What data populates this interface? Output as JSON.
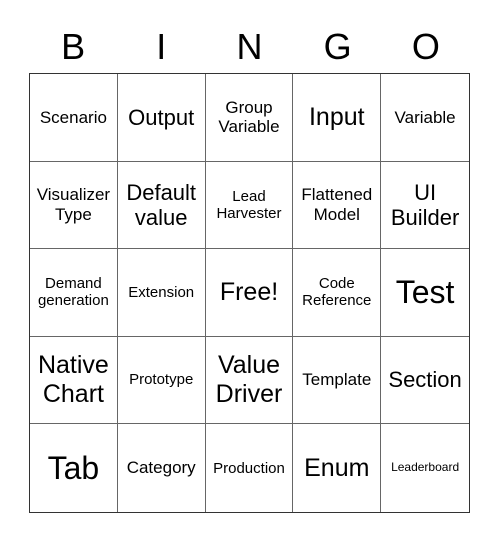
{
  "header": {
    "letters": [
      "B",
      "I",
      "N",
      "G",
      "O"
    ]
  },
  "board": {
    "rows": [
      [
        {
          "text": "Scenario",
          "size": "md"
        },
        {
          "text": "Output",
          "size": "lg"
        },
        {
          "text": "Group Variable",
          "size": "md"
        },
        {
          "text": "Input",
          "size": "xl"
        },
        {
          "text": "Variable",
          "size": "md"
        }
      ],
      [
        {
          "text": "Visualizer Type",
          "size": "md"
        },
        {
          "text": "Default value",
          "size": "lg"
        },
        {
          "text": "Lead Harvester",
          "size": "sm"
        },
        {
          "text": "Flattened Model",
          "size": "md"
        },
        {
          "text": "UI Builder",
          "size": "lg"
        }
      ],
      [
        {
          "text": "Demand generation",
          "size": "sm"
        },
        {
          "text": "Extension",
          "size": "sm"
        },
        {
          "text": "Free!",
          "size": "xl",
          "free": true
        },
        {
          "text": "Code Reference",
          "size": "sm"
        },
        {
          "text": "Test",
          "size": "xxl"
        }
      ],
      [
        {
          "text": "Native Chart",
          "size": "xl"
        },
        {
          "text": "Prototype",
          "size": "sm"
        },
        {
          "text": "Value Driver",
          "size": "xl"
        },
        {
          "text": "Template",
          "size": "md"
        },
        {
          "text": "Section",
          "size": "lg"
        }
      ],
      [
        {
          "text": "Tab",
          "size": "xxl"
        },
        {
          "text": "Category",
          "size": "md"
        },
        {
          "text": "Production",
          "size": "sm"
        },
        {
          "text": "Enum",
          "size": "xl"
        },
        {
          "text": "Leaderboard",
          "size": "xs"
        }
      ]
    ]
  }
}
